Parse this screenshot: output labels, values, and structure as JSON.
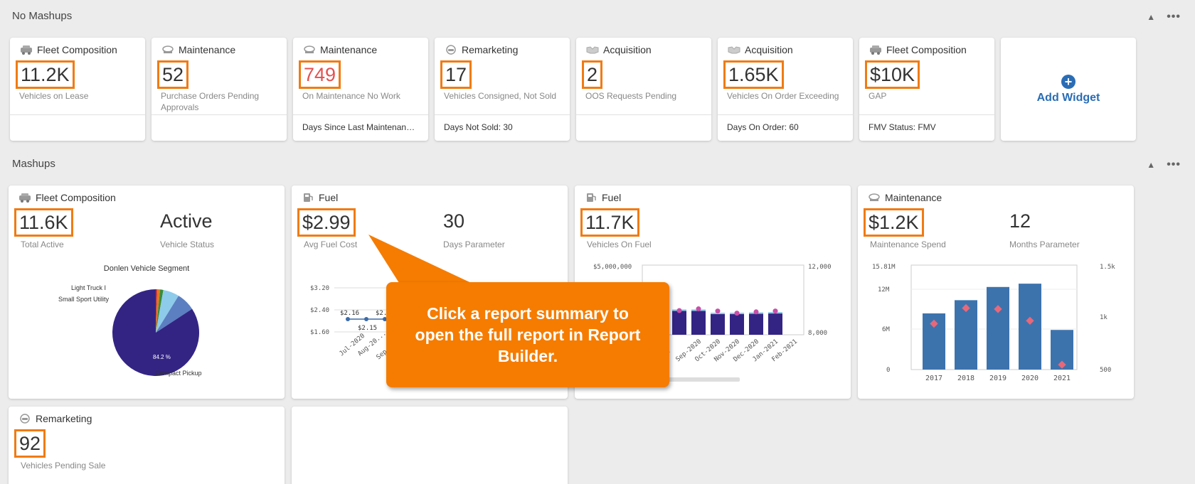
{
  "sections": {
    "no_mashups": {
      "title": "No Mashups"
    },
    "mashups": {
      "title": "Mashups"
    }
  },
  "controls": {
    "collapse": "▲",
    "more": "•••"
  },
  "widgets": [
    {
      "category": "Fleet Composition",
      "icon": "car-icon",
      "value": "11.2K",
      "label": "Vehicles on Lease",
      "footer": ""
    },
    {
      "category": "Maintenance",
      "icon": "wrench-icon",
      "value": "52",
      "label": "Purchase Orders Pending Approvals",
      "footer": ""
    },
    {
      "category": "Maintenance",
      "icon": "wrench-icon",
      "value": "749",
      "label": "On Maintenance No Work",
      "footer": "Days Since Last Maintenance:...",
      "value_color": "#e45050"
    },
    {
      "category": "Remarketing",
      "icon": "car-sale-icon",
      "value": "17",
      "label": "Vehicles Consigned, Not Sold",
      "footer": "Days Not Sold: 30"
    },
    {
      "category": "Acquisition",
      "icon": "handshake-icon",
      "value": "2",
      "label": "OOS Requests Pending",
      "footer": ""
    },
    {
      "category": "Acquisition",
      "icon": "handshake-icon",
      "value": "1.65K",
      "label": "Vehicles On Order Exceeding",
      "footer": "Days On Order: 60"
    },
    {
      "category": "Fleet Composition",
      "icon": "car-icon",
      "value": "$10K",
      "label": "GAP",
      "footer": "FMV Status: FMV"
    }
  ],
  "add_widget": {
    "label": "Add Widget",
    "icon": "plus-circle-icon"
  },
  "mashups": {
    "fleet": {
      "category": "Fleet Composition",
      "value": "11.6K",
      "label": "Total Active",
      "value2": "Active",
      "label2": "Vehicle Status",
      "chart_data": {
        "type": "pie",
        "title": "Donlen Vehicle Segment",
        "slices": [
          {
            "label": "Compact Pickup",
            "value": 84.2,
            "color": "#332484"
          },
          {
            "label": "Small Sport Utility",
            "value": 7,
            "color": "#5b7fc1"
          },
          {
            "label": "Light Truck I",
            "value": 6,
            "color": "#8ecbea"
          },
          {
            "label": "",
            "value": 1.2,
            "color": "#3a8b3a"
          },
          {
            "label": "",
            "value": 1,
            "color": "#e07a20"
          },
          {
            "label": "",
            "value": 0.6,
            "color": "#c23b3b"
          }
        ],
        "slice_label": "84.2 %"
      }
    },
    "fuel1": {
      "category": "Fuel",
      "value": "$2.99",
      "label": "Avg Fuel Cost",
      "value2": "30",
      "label2": "Days Parameter",
      "chart_data": {
        "type": "line",
        "yticks": [
          "$3.20",
          "$2.40",
          "$1.60"
        ],
        "x": [
          "Jul-2020",
          "Aug-20...",
          "Sep-2020",
          "Oc"
        ],
        "values": [
          2.16,
          2.15,
          2.2
        ],
        "data_labels": [
          "$2.16",
          "$2.15",
          "$2."
        ]
      }
    },
    "fuel2": {
      "category": "Fuel",
      "value": "11.7K",
      "label": "Vehicles On Fuel",
      "chart_data": {
        "type": "bar",
        "y_left_ticks": [
          "$5,000,000"
        ],
        "y_right_ticks": [
          "12,000",
          "8,000"
        ],
        "categories": [
          "...0",
          "Sep-2020",
          "Oct-2020",
          "Nov-2020",
          "Dec-2020",
          "Jan-2021",
          "Feb-2021"
        ],
        "bars": [
          0.73,
          0.73,
          0.73,
          0.63,
          0.63,
          0.64,
          0.65
        ],
        "points": [
          0.52,
          0.56,
          0.6,
          0.55,
          0.5,
          0.53,
          0.55
        ]
      }
    },
    "maint": {
      "category": "Maintenance",
      "value": "$1.2K",
      "label": "Maintenance Spend",
      "value2": "12",
      "label2": "Months Parameter",
      "chart_data": {
        "type": "bar",
        "y_left_ticks": [
          "15.81M",
          "12M",
          "6M",
          "0"
        ],
        "y_right_ticks": [
          "1.5k",
          "1k",
          "500"
        ],
        "categories": [
          "2017",
          "2018",
          "2019",
          "2020",
          "2021"
        ],
        "values": [
          8.5,
          10.5,
          12.5,
          13,
          6
        ],
        "points": [
          900,
          1060,
          1050,
          930,
          480
        ]
      }
    },
    "remarketing": {
      "category": "Remarketing",
      "value": "92",
      "label": "Vehicles Pending Sale"
    }
  },
  "callout": {
    "text": "Click a report summary to open the full report in Report Builder."
  }
}
